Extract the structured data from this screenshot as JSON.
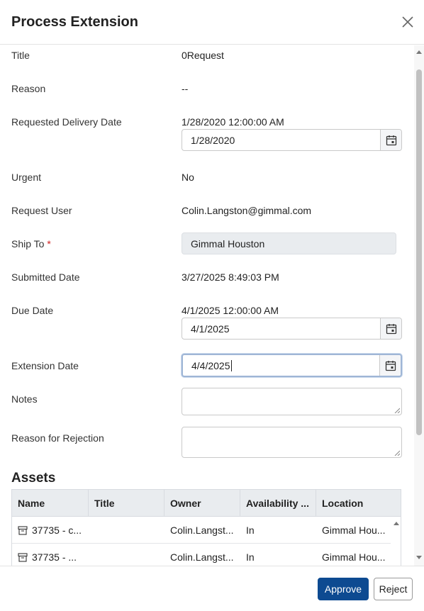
{
  "dialog": {
    "title": "Process Extension"
  },
  "fields": {
    "title": {
      "label": "Title",
      "value": "0Request"
    },
    "reason": {
      "label": "Reason",
      "value": "--"
    },
    "requested_delivery_date": {
      "label": "Requested Delivery Date",
      "value": "1/28/2020 12:00:00 AM",
      "input_value": "1/28/2020"
    },
    "urgent": {
      "label": "Urgent",
      "value": "No"
    },
    "request_user": {
      "label": "Request User",
      "value": "Colin.Langston@gimmal.com"
    },
    "ship_to": {
      "label": "Ship To",
      "required_marker": "*",
      "value": "Gimmal Houston"
    },
    "submitted_date": {
      "label": "Submitted Date",
      "value": "3/27/2025 8:49:03 PM"
    },
    "due_date": {
      "label": "Due Date",
      "value": "4/1/2025 12:00:00 AM",
      "input_value": "4/1/2025"
    },
    "extension_date": {
      "label": "Extension Date",
      "input_value": "4/4/2025"
    },
    "notes": {
      "label": "Notes",
      "value": ""
    },
    "reason_for_rejection": {
      "label": "Reason for Rejection",
      "value": ""
    }
  },
  "assets": {
    "title": "Assets",
    "columns": [
      "Name",
      "Title",
      "Owner",
      "Availability ...",
      "Location"
    ],
    "rows": [
      {
        "name": "37735 - c...",
        "title": "",
        "owner": "Colin.Langst...",
        "availability": "In",
        "location": "Gimmal Hou..."
      },
      {
        "name": "37735 - ...",
        "title": "",
        "owner": "Colin.Langst...",
        "availability": "In",
        "location": "Gimmal Hou..."
      }
    ]
  },
  "footer": {
    "approve_label": "Approve",
    "reject_label": "Reject"
  },
  "colors": {
    "primary": "#0d4a91",
    "required": "#d02020",
    "readonly_bg": "#e9ecef"
  }
}
